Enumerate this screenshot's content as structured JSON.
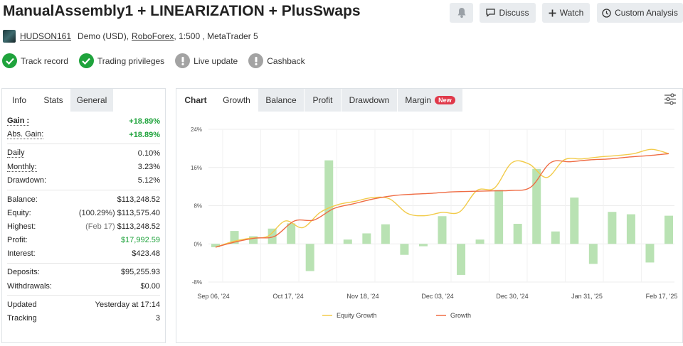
{
  "header": {
    "title": "ManualAssembly1 + LINEARIZATION + PlusSwaps",
    "buttons": {
      "discuss": "Discuss",
      "watch": "Watch",
      "custom": "Custom Analysis"
    }
  },
  "meta": {
    "username": "HUDSON161",
    "account": "Demo (USD),",
    "broker": "RoboForex",
    "rest": ", 1:500 , MetaTrader 5"
  },
  "badges": [
    {
      "label": "Track record",
      "status": "ok"
    },
    {
      "label": "Trading privileges",
      "status": "ok"
    },
    {
      "label": "Live update",
      "status": "off"
    },
    {
      "label": "Cashback",
      "status": "off"
    }
  ],
  "left_tabs": [
    "Info",
    "Stats",
    "General"
  ],
  "stats": {
    "gain": {
      "label": "Gain :",
      "value": "+18.89%"
    },
    "abs_gain": {
      "label": "Abs. Gain:",
      "value": "+18.89%"
    },
    "daily": {
      "label": "Daily",
      "value": "0.10%"
    },
    "monthly": {
      "label": "Monthly:",
      "value": "3.23%"
    },
    "drawdown": {
      "label": "Drawdown:",
      "value": "5.12%"
    },
    "balance": {
      "label": "Balance:",
      "value": "$113,248.52"
    },
    "equity": {
      "label": "Equity:",
      "prefix": "(100.29%)",
      "value": "$113,575.40"
    },
    "highest": {
      "label": "Highest:",
      "prefix": "(Feb 17)",
      "value": "$113,248.52"
    },
    "profit": {
      "label": "Profit:",
      "value": "$17,992.59"
    },
    "interest": {
      "label": "Interest:",
      "value": "$423.48"
    },
    "deposits": {
      "label": "Deposits:",
      "value": "$95,255.93"
    },
    "withdrawals": {
      "label": "Withdrawals:",
      "value": "$0.00"
    },
    "updated": {
      "label": "Updated",
      "value": "Yesterday at 17:14"
    },
    "tracking": {
      "label": "Tracking",
      "value": "3"
    }
  },
  "chart_tabs": {
    "chart": "Chart",
    "items": [
      "Growth",
      "Balance",
      "Profit",
      "Drawdown",
      "Margin"
    ],
    "new_badge": "New"
  },
  "colors": {
    "growth_line": "#ef6c44",
    "equity_line": "#f2cb4a",
    "bars": "#b9e2b3",
    "ok_badge": "#1fa33c",
    "green_text": "#1fa33c"
  },
  "chart_data": {
    "type": "bar",
    "ylim": [
      -8,
      24
    ],
    "y_ticks": [
      "24%",
      "16%",
      "8%",
      "0%",
      "-8%"
    ],
    "x_tick_labels": [
      "Sep 06, '24",
      "Oct 17, '24",
      "Nov 18, '24",
      "Dec 03, '24",
      "Dec 30, '24",
      "Jan 31, '25",
      "Feb 17, '25"
    ],
    "bar_values": [
      -0.7,
      2.7,
      1.6,
      3.2,
      4.3,
      -5.7,
      17.5,
      0.9,
      2.2,
      4.1,
      -2.3,
      -0.5,
      5.8,
      -6.5,
      0.9,
      11.3,
      4.2,
      15.7,
      2.6,
      9.7,
      -4.2,
      6.7,
      6.2,
      -3.9,
      5.9
    ],
    "series": [
      {
        "name": "Equity Growth",
        "values": [
          -0.7,
          0.5,
          1.2,
          1.6,
          4.8,
          3.4,
          6.6,
          8.2,
          8.9,
          9.7,
          9.4,
          6.4,
          5.9,
          6.6,
          6.7,
          11.2,
          11.7,
          17.0,
          16.7,
          13.9,
          17.6,
          17.8,
          18.2,
          18.5,
          18.9,
          19.8,
          18.9
        ]
      },
      {
        "name": "Growth",
        "values": [
          -0.7,
          0.4,
          1.2,
          1.6,
          4.8,
          5.0,
          7.4,
          8.4,
          9.4,
          10.1,
          10.4,
          10.6,
          10.9,
          11.0,
          11.1,
          11.2,
          11.9,
          17.0,
          17.2,
          17.6,
          17.8,
          18.2,
          18.5,
          18.9
        ]
      }
    ]
  }
}
